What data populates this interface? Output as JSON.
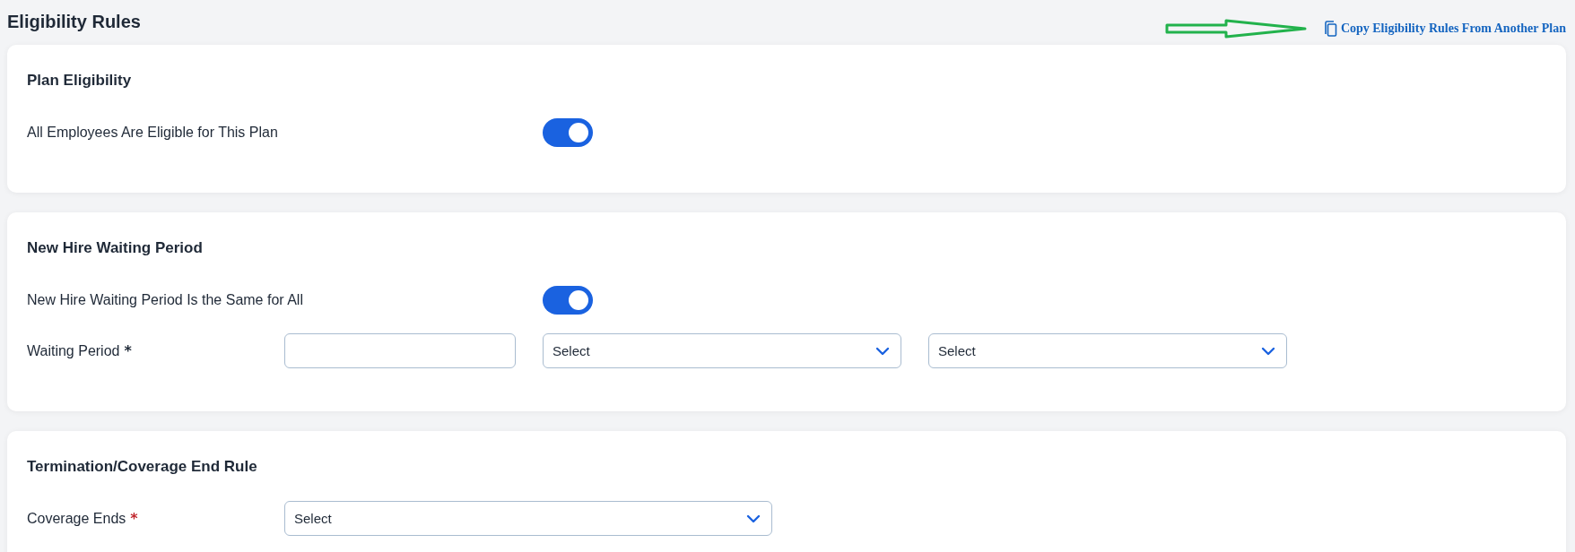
{
  "page_title": "Eligibility Rules",
  "copy_link": {
    "label": "Copy Eligibility Rules From Another Plan"
  },
  "sections": [
    {
      "title": "Plan Eligibility",
      "rows": [
        {
          "kind": "toggle",
          "label": "All Employees Are Eligible for This Plan",
          "on": true
        }
      ]
    },
    {
      "title": "New Hire Waiting Period",
      "rows": [
        {
          "kind": "toggle",
          "label": "New Hire Waiting Period Is the Same for All",
          "on": true
        },
        {
          "kind": "fields",
          "label": "Waiting Period",
          "required_mark": {
            "text": "*",
            "color": "#1f2937"
          },
          "controls": [
            {
              "kind": "text"
            },
            {
              "kind": "select",
              "placeholder": "Select"
            },
            {
              "kind": "select",
              "placeholder": "Select"
            }
          ]
        }
      ]
    },
    {
      "title": "Termination/Coverage End Rule",
      "rows": [
        {
          "kind": "fields",
          "label": "Coverage Ends",
          "required_mark": {
            "text": "*",
            "color": "#c0262d"
          },
          "controls": [
            {
              "kind": "select",
              "placeholder": "Select"
            }
          ]
        }
      ]
    }
  ]
}
